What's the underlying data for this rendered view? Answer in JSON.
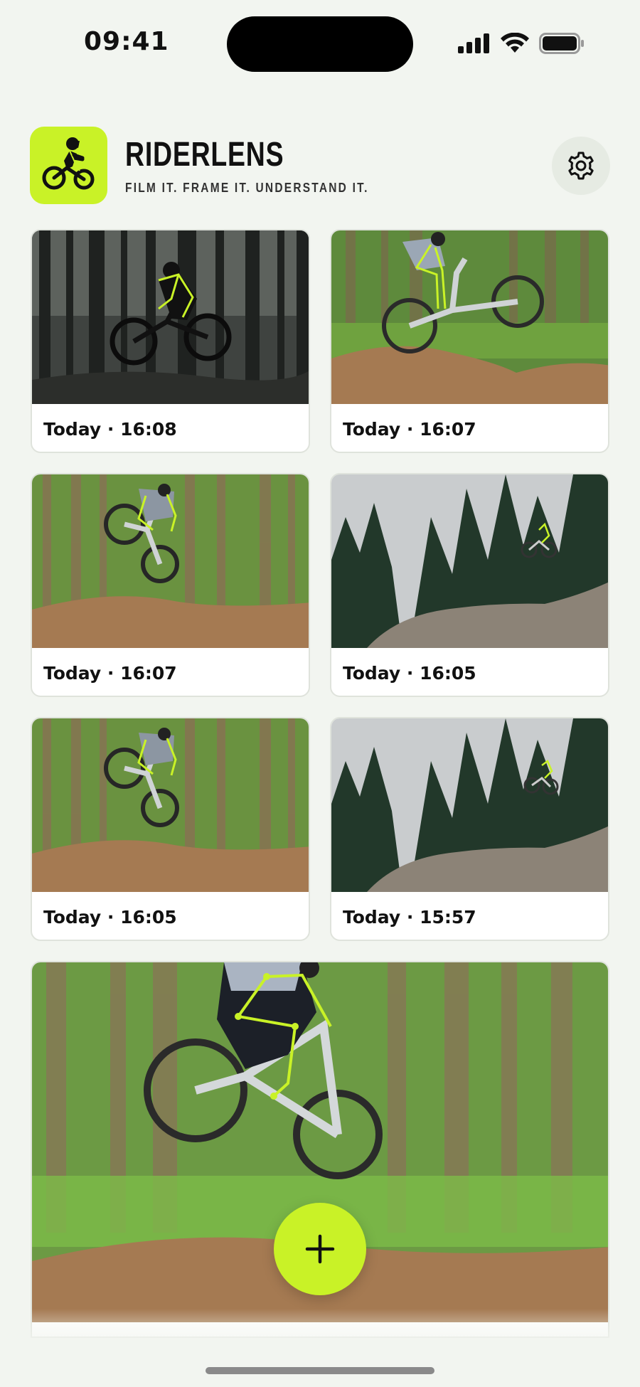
{
  "status_bar": {
    "time": "09:41"
  },
  "app": {
    "name": "RIDERLENS",
    "tagline": "FILM IT. FRAME IT. UNDERSTAND IT.",
    "accent_color": "#c9f227"
  },
  "icons": {
    "logo": "bike-rider-logo-icon",
    "settings": "gear-icon",
    "add": "plus-icon"
  },
  "clips": [
    {
      "label": "Today · 16:08",
      "scene": "dark-forest-jump"
    },
    {
      "label": "Today · 16:07",
      "scene": "green-forest-dirt-jump"
    },
    {
      "label": "Today · 16:07",
      "scene": "green-forest-high-jump"
    },
    {
      "label": "Today · 16:05",
      "scene": "pine-sky-dirt-mound"
    },
    {
      "label": "Today · 16:05",
      "scene": "green-forest-high-jump"
    },
    {
      "label": "Today · 15:57",
      "scene": "pine-sky-dirt-mound"
    },
    {
      "label": "",
      "scene": "green-forest-closeup-jump"
    }
  ]
}
